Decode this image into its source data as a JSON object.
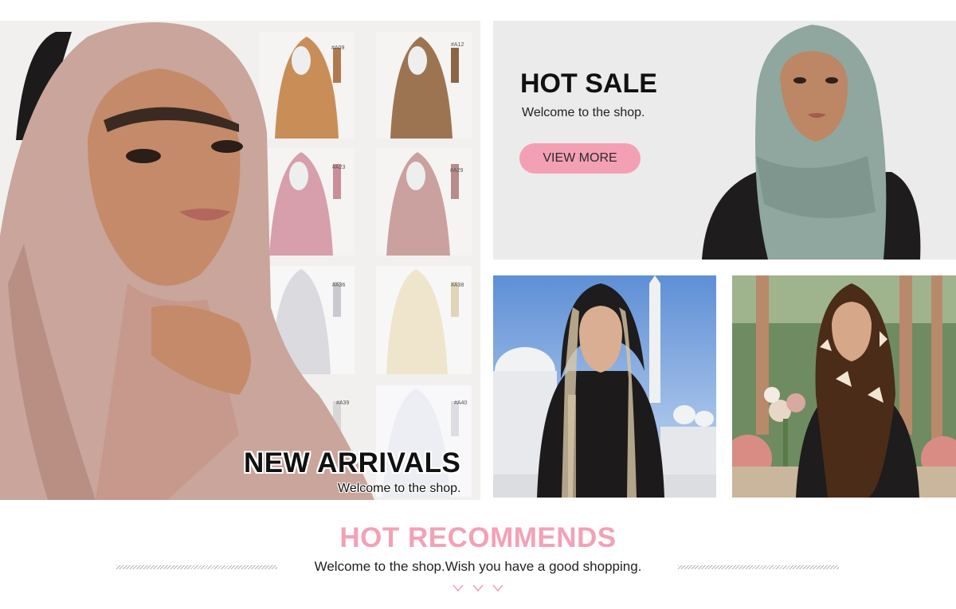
{
  "banners": {
    "new_arrivals": {
      "title": "NEW ARRIVALS",
      "subtitle": "Welcome to the shop."
    },
    "hot_sale": {
      "title": "HOT SALE",
      "subtitle": "Welcome to the shop.",
      "button_label": "VIEW MORE"
    },
    "swatch_labels": [
      "#A09",
      "#A12",
      "#A23",
      "#A29",
      "#A36",
      "#A38",
      "#A39",
      "#A40"
    ]
  },
  "recommends": {
    "title": "HOT RECOMMENDS",
    "subtitle": "Welcome to the shop.Wish you have a good shopping."
  },
  "colors": {
    "accent_pink": "#f3a1b5",
    "button_pink": "#f4a0b4"
  }
}
